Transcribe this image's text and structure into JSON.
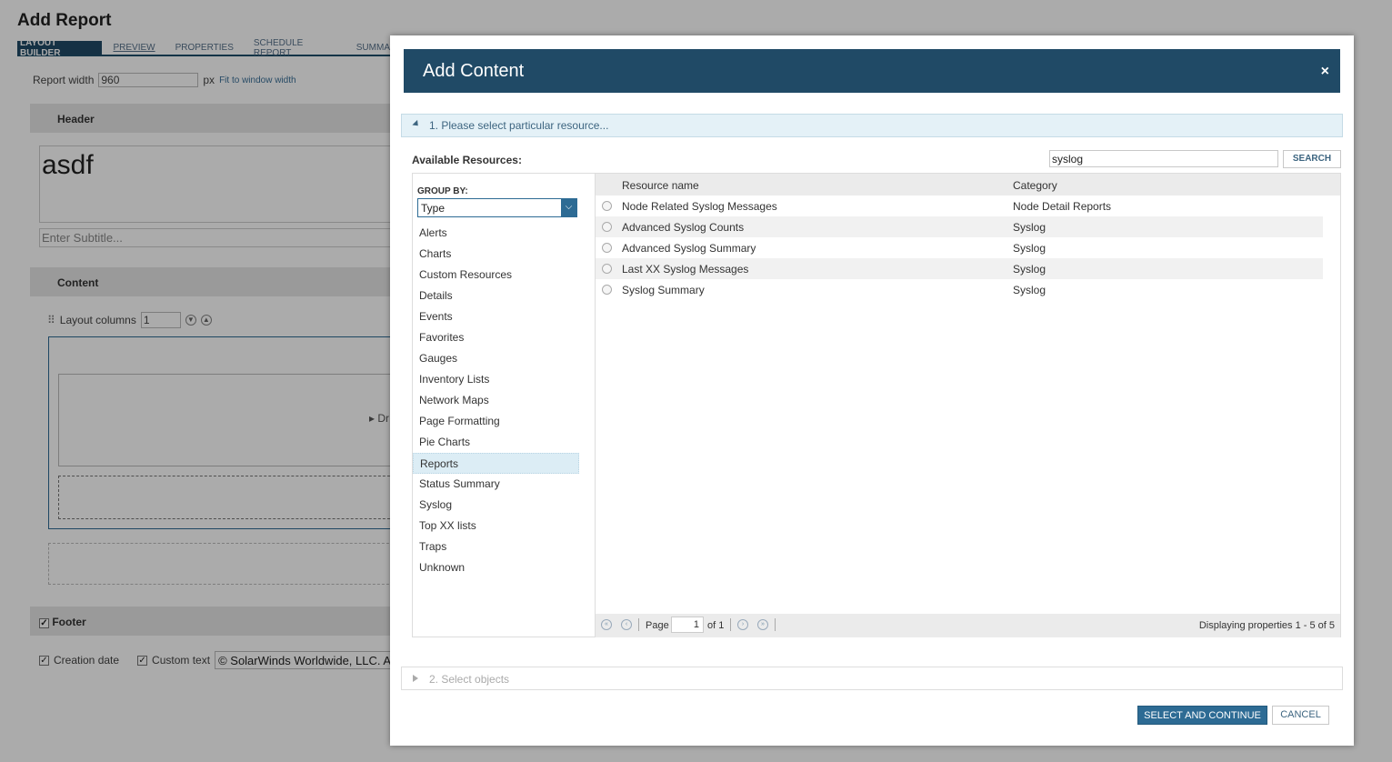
{
  "background": {
    "page_title": "Add Report",
    "steps": [
      "LAYOUT BUILDER",
      "PREVIEW",
      "PROPERTIES",
      "SCHEDULE REPORT",
      "SUMMA"
    ],
    "report_width_label": "Report width",
    "report_width_value": "960",
    "px_label": "px",
    "fit_link": "Fit to window width",
    "header_label": "Header",
    "header_title": "asdf",
    "subtitle_placeholder": "Enter Subtitle...",
    "content_label": "Content",
    "layout_columns_label": "Layout columns",
    "layout_columns_value": "1",
    "drop_hint": "Dr",
    "footer_label": "Footer",
    "creation_date_label": "Creation date",
    "custom_text_label": "Custom text",
    "custom_text_value": "© SolarWinds Worldwide, LLC. A"
  },
  "modal": {
    "title": "Add Content",
    "close_icon": "×",
    "step1_label": "1. Please select particular resource...",
    "available_label": "Available Resources:",
    "search_value": "syslog",
    "search_button": "SEARCH",
    "group_by_label": "GROUP BY:",
    "group_by_value": "Type",
    "types": [
      "Alerts",
      "Charts",
      "Custom Resources",
      "Details",
      "Events",
      "Favorites",
      "Gauges",
      "Inventory Lists",
      "Network Maps",
      "Page Formatting",
      "Pie Charts",
      "Reports",
      "Status Summary",
      "Syslog",
      "Top XX lists",
      "Traps",
      "Unknown"
    ],
    "selected_type": "Reports",
    "columns": {
      "name": "Resource name",
      "category": "Category"
    },
    "rows": [
      {
        "name": "Node Related Syslog Messages",
        "category": "Node Detail Reports"
      },
      {
        "name": "Advanced Syslog Counts",
        "category": "Syslog"
      },
      {
        "name": "Advanced Syslog Summary",
        "category": "Syslog"
      },
      {
        "name": "Last XX Syslog Messages",
        "category": "Syslog"
      },
      {
        "name": "Syslog Summary",
        "category": "Syslog"
      }
    ],
    "pager": {
      "page_label": "Page",
      "page_value": "1",
      "of_label": "of 1",
      "display": "Displaying properties 1 - 5 of 5"
    },
    "step2_label": "2. Select objects",
    "select_continue": "SELECT AND CONTINUE",
    "cancel": "CANCEL"
  },
  "colors": {
    "accent": "#204a66",
    "button": "#2d6b94",
    "step_bg": "#e4f1f7"
  }
}
